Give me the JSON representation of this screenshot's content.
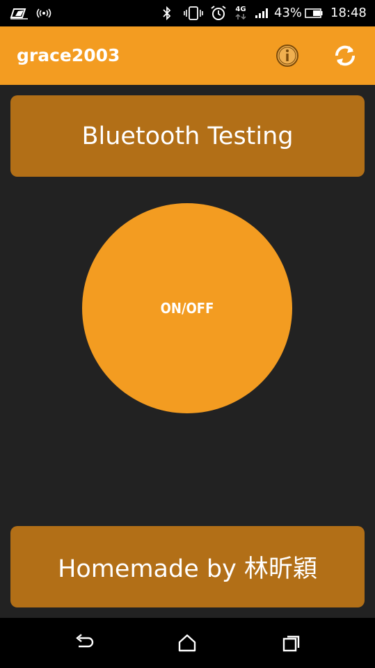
{
  "status_bar": {
    "battery_percent": "43%",
    "time": "18:48",
    "network_type": "4G",
    "icons": [
      "battery-saver-icon",
      "nfc-icon",
      "bluetooth-icon",
      "vibrate-icon",
      "alarm-icon",
      "network-4g-icon",
      "signal-icon",
      "battery-icon"
    ]
  },
  "app_bar": {
    "title": "grace2003",
    "actions": [
      "info-icon",
      "refresh-icon"
    ]
  },
  "header_banner": {
    "text": "Bluetooth Testing"
  },
  "power_button": {
    "label": "ON/OFF"
  },
  "footer_banner": {
    "text": "Homemade by 林昕穎"
  },
  "nav_bar": {
    "buttons": [
      "back-icon",
      "home-icon",
      "recents-icon"
    ]
  },
  "colors": {
    "app_bar": "#f39c21",
    "banner": "#b26f17",
    "background": "#222222",
    "power_button": "#f39c21"
  }
}
